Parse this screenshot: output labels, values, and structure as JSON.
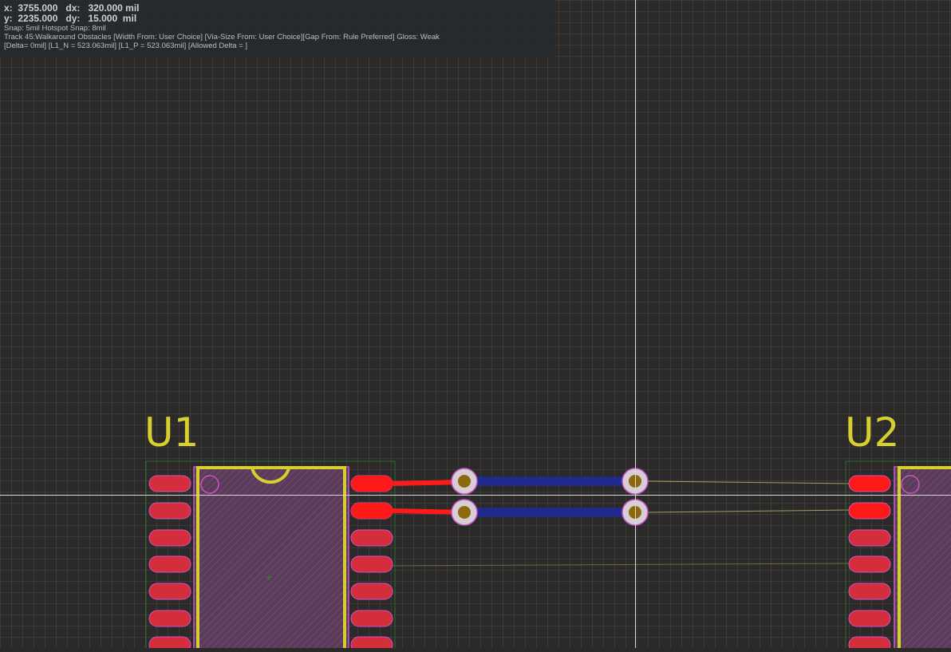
{
  "hud": {
    "x_label": "x:",
    "x_value": "3755.000",
    "dx_label": "dx:",
    "dx_value": "320.000 mil",
    "y_label": "y:",
    "y_value": "2235.000",
    "dy_label": "dy:",
    "dy_value": "15.000  mil",
    "snap_line": "Snap: 5mil Hotspot Snap: 8mil",
    "track_line": "Track 45:Walkaround Obstacles [Width From: User Choice] [Via-Size From: User Choice][Gap From: Rule Preferred] Gloss: Weak",
    "delta_line": "[Delta= 0mil] [L1_N = 523.063mil] [L1_P = 523.063mil] [Allowed Delta = ]"
  },
  "designators": {
    "u1": "U1",
    "u2": "U2"
  },
  "colors": {
    "background": "#2b2a29",
    "grid": "#4a4a4a",
    "top_layer": "#ff1a1a",
    "bottom_layer": "#202a8c",
    "pad": "#d42e3c",
    "overlay": "#d6cf2e",
    "courtyard": "#c855c8",
    "via_ring": "#d8cdd6",
    "via_hole": "#8a6a0c",
    "crosshair": "#d8d8d8"
  }
}
